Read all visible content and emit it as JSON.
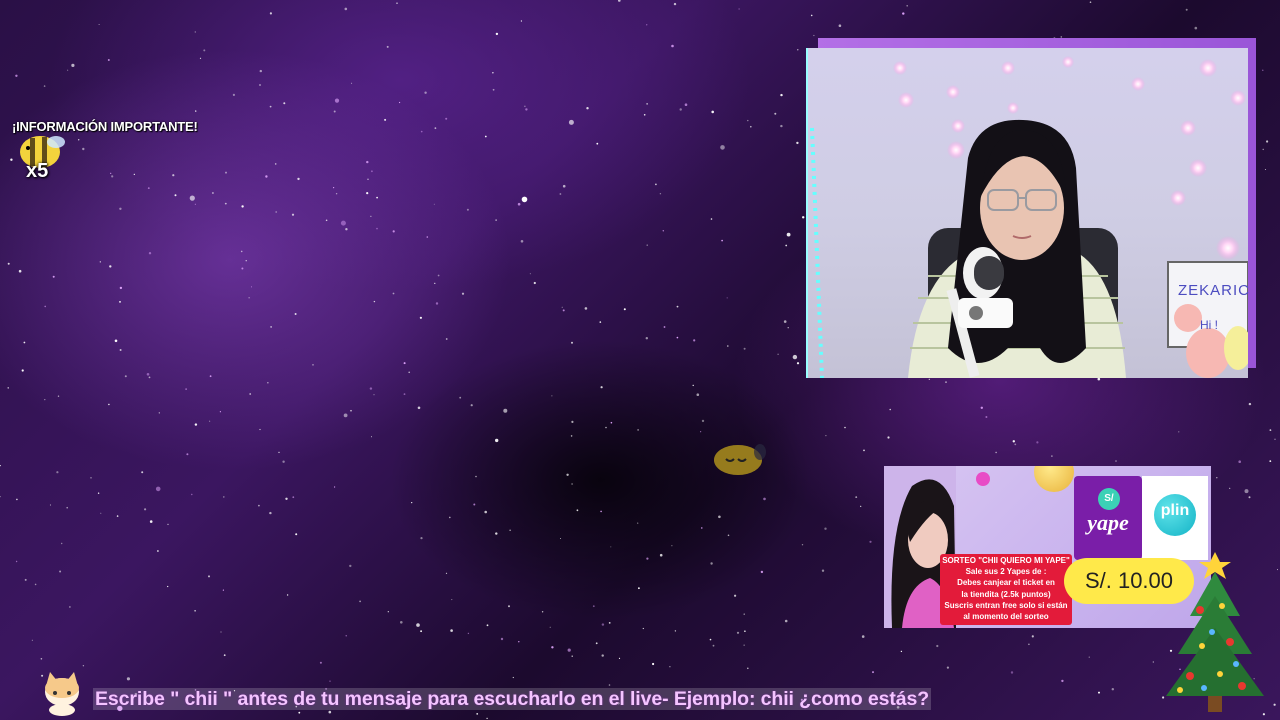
{
  "alert": {
    "title": "¡INFORMACIÓN IMPORTANTE!",
    "multiplier": "x5"
  },
  "promo": {
    "yape_symbol": "S/",
    "yape_brand": "yape",
    "plin_brand": "plin",
    "raffle_lines": [
      "SORTEO \"CHII QUIERO MI YAPE\"",
      "Sale sus 2 Yapes de :",
      "Debes canjear el ticket en",
      "la tiendita (2.5k puntos)",
      "Suscris entran free solo si están",
      "al momento del sorteo"
    ],
    "price": "S/. 10.00"
  },
  "webcam": {
    "board_text": "ZEKARIC",
    "board_sub": "Hi !"
  },
  "ticker": {
    "text": "Escribe \" chii \" antes de tu mensaje para escucharlo en el live- Ejemplo: chii ¿como estás?"
  },
  "colors": {
    "accent": "#9a55d8",
    "raffle": "#e31b3a",
    "price_bg": "#ffe94a",
    "ticker_text": "#f4c4ff"
  },
  "icons": [
    "bee-icon",
    "cat-mascot-icon",
    "christmas-tree-icon",
    "yape-logo",
    "plin-logo"
  ]
}
